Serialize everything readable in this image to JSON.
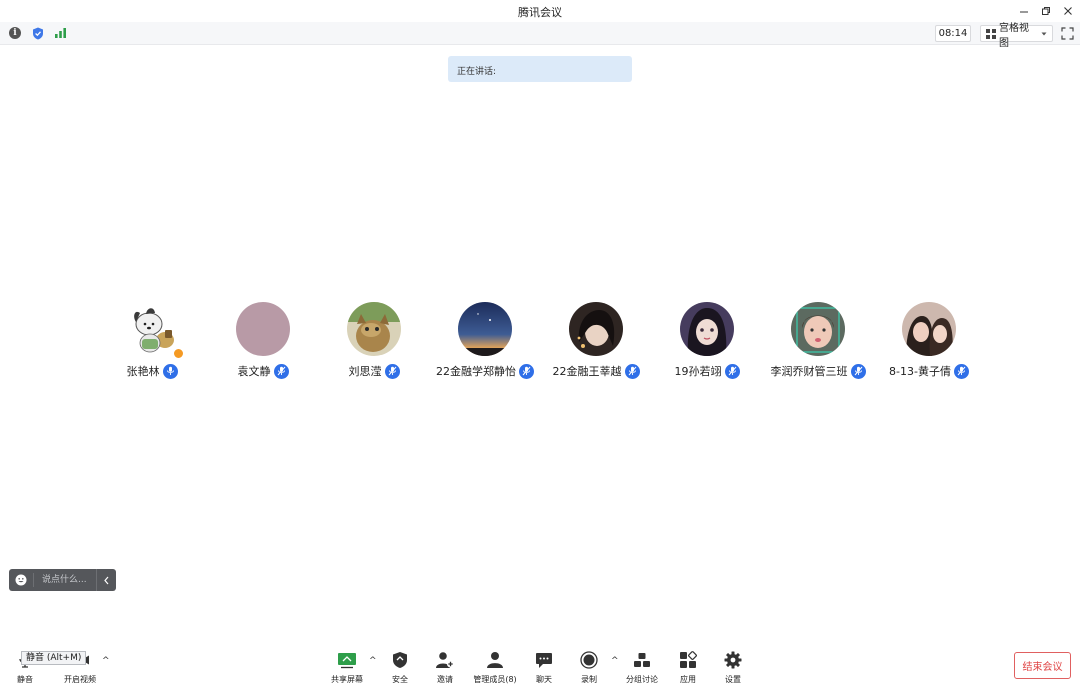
{
  "window": {
    "title": "腾讯会议"
  },
  "infobar": {
    "timer": "08:14",
    "view_mode": "宫格视图"
  },
  "speaking": {
    "label": "正在讲话:"
  },
  "participants": [
    {
      "name": "张艳林",
      "avatar_color": "#eef0ea"
    },
    {
      "name": "袁文静",
      "avatar_color": "#b89aa6"
    },
    {
      "name": "刘思滢",
      "avatar_color": "#b59a64"
    },
    {
      "name": "22金融学郑静怡",
      "avatar_color": "#2f4a80"
    },
    {
      "name": "22金融王莘越",
      "avatar_color": "#2e2522"
    },
    {
      "name": "19孙若翊",
      "avatar_color": "#463c5e"
    },
    {
      "name": "李润乔财管三班",
      "avatar_color": "#9b8a7c"
    },
    {
      "name": "8-13-黄子倩",
      "avatar_color": "#b59688"
    }
  ],
  "chat": {
    "placeholder": "说点什么..."
  },
  "toolbar": {
    "tooltip": "静音 (Alt+M)",
    "mute": "静音",
    "video": "开启视频",
    "share": "共享屏幕",
    "security": "安全",
    "invite": "邀请",
    "members": "管理成员(8)",
    "chat": "聊天",
    "record": "录制",
    "breakout": "分组讨论",
    "apps": "应用",
    "settings": "设置",
    "end": "结束会议"
  },
  "colors": {
    "accent_blue": "#2f6fe8",
    "end_red": "#e04545",
    "speaking_bg": "#dceaf9",
    "share_green": "#2e9e4a"
  }
}
